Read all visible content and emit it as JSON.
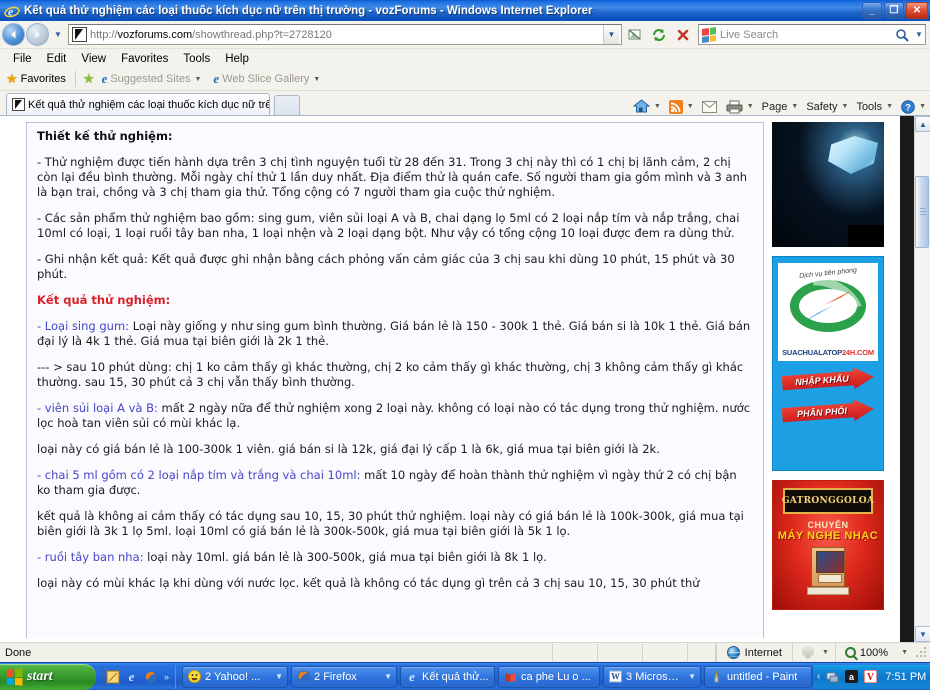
{
  "window": {
    "title": "Kết quả thử nghiệm các loại thuốc kích dục nữ trên thị trường - vozForums - Windows Internet Explorer",
    "icon": "ie-logo-icon",
    "minimize_label": "_",
    "restore_label": "❐",
    "close_label": "✕"
  },
  "navbar": {
    "back_label": "◀",
    "forward_label": "▶",
    "history_caret": "▼",
    "url_scheme": "http://",
    "url_host": "vozforums.com",
    "url_path": "/showthread.php?t=2728120",
    "url_full": "http://vozforums.com/showthread.php?t=2728120",
    "address_caret": "▼",
    "compat_icon": "compatibility-view-icon",
    "refresh_icon": "refresh-icon",
    "stop_icon": "stop-icon",
    "search_placeholder": "Live Search",
    "search_go_icon": "search-icon",
    "search_caret": "▼"
  },
  "menubar": {
    "items": [
      "File",
      "Edit",
      "View",
      "Favorites",
      "Tools",
      "Help"
    ]
  },
  "favbar": {
    "favorites_label": "Favorites",
    "suggested_sites_label": "Suggested Sites",
    "web_slice_label": "Web Slice Gallery",
    "caret": "▼"
  },
  "tabs": {
    "items": [
      {
        "label": "Kết quả thử nghiệm các loại thuốc kích dục nữ trên thị...",
        "icon": "voz-favicon"
      }
    ],
    "new_tab_label": ""
  },
  "commandbar": {
    "home_label": "",
    "feeds_label": "",
    "read_mail_label": "",
    "print_label": "",
    "page_label": "Page",
    "safety_label": "Safety",
    "tools_label": "Tools",
    "help_label": "?",
    "overflow_label": "»",
    "caret": "▼"
  },
  "post": {
    "paragraphs": [
      {
        "style": "header-bold",
        "text": "Thiết kế thử nghiệm:"
      },
      {
        "style": "body",
        "text": "- Thử nghiệm được tiến hành dựa trên 3 chị tình nguyện tuổi từ 28 đến 31. Trong 3 chị này thì có 1 chị bị lãnh cảm, 2 chị còn lại đều bình thường. Mỗi ngày chỉ thử 1 lần duy nhất. Địa điểm thử là quán cafe. Số người tham gia gồm mình và 3 anh là bạn trai, chồng và 3 chị tham gia thử. Tổng cộng có 7 người tham gia cuộc thử nghiệm."
      },
      {
        "style": "body",
        "text": "- Các sản phẩm thử nghiệm bao gồm: sing gum, viên sủi loại A và B, chai dạng lọ 5ml có 2 loại nắp tím và nắp trắng, chai 10ml có loại, 1 loại ruồi tây ban nha, 1 loại nhện và 2 loại dạng bột. Như vậy có tổng cộng 10 loại được đem ra dùng thử."
      },
      {
        "style": "body",
        "text": "- Ghi nhận kết quả: Kết quả được ghi nhận bằng cách phỏng vấn cảm giác của 3 chị sau khi dùng 10 phút, 15 phút và 30 phút."
      },
      {
        "style": "header-red",
        "text": "Kết quả thử nghiệm:"
      },
      {
        "style": "link-lead",
        "link": "- Loại sing gum:",
        "text": " Loại này giống y như sing gum bình thường. Giá bán lẻ là 150 - 300k 1 thẻ. Giá bán si là 10k 1 thẻ. Giá bán đại lý là 4k 1 thẻ. Giá mua tại biên giới là 2k 1 thẻ."
      },
      {
        "style": "body",
        "text": "--- > sau 10 phút dùng: chị 1 ko cảm thấy gì khác thường, chị 2 ko cảm thấy gì khác thường, chị 3 không cảm thấy gì khác thường. sau 15, 30 phút cả 3 chị vẫn thấy bình thường."
      },
      {
        "style": "link-lead",
        "link": "- viên sủi loại A và B:",
        "text": " mất 2 ngày nữa để thử nghiệm xong 2 loại này. không có loại nào có tác dụng trong thử nghiệm. nước lọc hoà tan viên sủi có mùi khác lạ."
      },
      {
        "style": "body",
        "text": "loại này có giá bán lẻ là 100-300k 1 viên. giá bán si là 12k, giá đại lý cấp 1 là 6k, giá mua tại biên giới là 2k."
      },
      {
        "style": "link-lead",
        "link": "- chai 5 ml gồm có 2 loại nắp tím và trắng và chai 10ml:",
        "text": " mất 10 ngày để hoàn thành thử nghiệm vì ngày thứ 2 có chị bận ko tham gia được."
      },
      {
        "style": "body",
        "text": "kết quả là không ai cảm thấy có tác dụng sau 10, 15, 30 phút thử nghiệm. loại này có giá bán lẻ là 100k-300k, giá mua tại biên giới là 3k 1 lọ 5ml. loại 10ml có giá bán lẻ là 300k-500k, giá mua tại biên giới là 5k 1 lọ."
      },
      {
        "style": "link-lead",
        "link": "- ruồi tây ban nha:",
        "text": " loại này 10ml. giá bán lẻ là 300-500k, giá mua tại biên giới là 8k 1 lọ."
      },
      {
        "style": "body",
        "text": "loại này có mùi khác lạ khi dùng với nước lọc. kết quả là không có tác dụng gì trên cả 3 chị sau 10, 15, 30 phút thử"
      }
    ]
  },
  "ads": [
    {
      "name": "ice-water-banner",
      "alt": ""
    },
    {
      "name": "suachualatop24h-banner",
      "tagline": "Dịch vụ tiên phong",
      "brand": "SUACHUALATOP",
      "brand_accent": "24H.COM",
      "button1": "NHẬP KHẨU",
      "button2": "PHÂN PHỐI"
    },
    {
      "name": "gatronggoloa-banner",
      "plate": "GATRONGGOLOA",
      "line1": "CHUYÊN",
      "line2": "MÁY NGHE NHẠC"
    }
  ],
  "scrollbar": {
    "up_arrow": "▲",
    "down_arrow": "▼"
  },
  "statusbar": {
    "status_text": "Done",
    "zone_label": "Internet",
    "zone_icon": "globe-icon",
    "protected_mode_icon": "shield-icon",
    "protected_caret": "▼",
    "zoom_label": "100%",
    "zoom_icon": "magnifier-icon",
    "zoom_caret": "▼"
  },
  "taskbar": {
    "start_label": "start",
    "quicklaunch": [
      {
        "name": "show-desktop-icon",
        "glyph": "▨"
      },
      {
        "name": "internet-explorer-icon",
        "glyph": "e"
      },
      {
        "name": "firefox-icon",
        "glyph": "●"
      }
    ],
    "quicklaunch_overflow": "»",
    "tasks": [
      {
        "label": "2 Yahoo! ...",
        "icon": "yahoo-messenger-icon",
        "caret": "▼"
      },
      {
        "label": "2 Firefox",
        "icon": "firefox-icon",
        "caret": "▼"
      },
      {
        "label": "Kết quả thử...",
        "icon": "internet-explorer-icon",
        "caret": ""
      },
      {
        "label": "ca phe Lu o ...",
        "icon": "book-icon",
        "caret": ""
      },
      {
        "label": "3 Microsof...",
        "icon": "word-icon",
        "caret": "▼"
      },
      {
        "label": "untitled - Paint",
        "icon": "paint-icon",
        "caret": ""
      }
    ],
    "tray": {
      "expand_caret": "‹",
      "icons": [
        {
          "name": "network-icon",
          "glyph": "▣"
        },
        {
          "name": "avg-icon",
          "glyph": "a"
        },
        {
          "name": "unikey-icon",
          "glyph": "V"
        }
      ],
      "clock": "7:51 PM"
    }
  },
  "colors": {
    "titlebar_blue": "#1d6fe0",
    "header_red": "#d8222a",
    "link_purple": "#4646c8",
    "taskbar_blue": "#2468d8",
    "start_green": "#369b2c"
  }
}
